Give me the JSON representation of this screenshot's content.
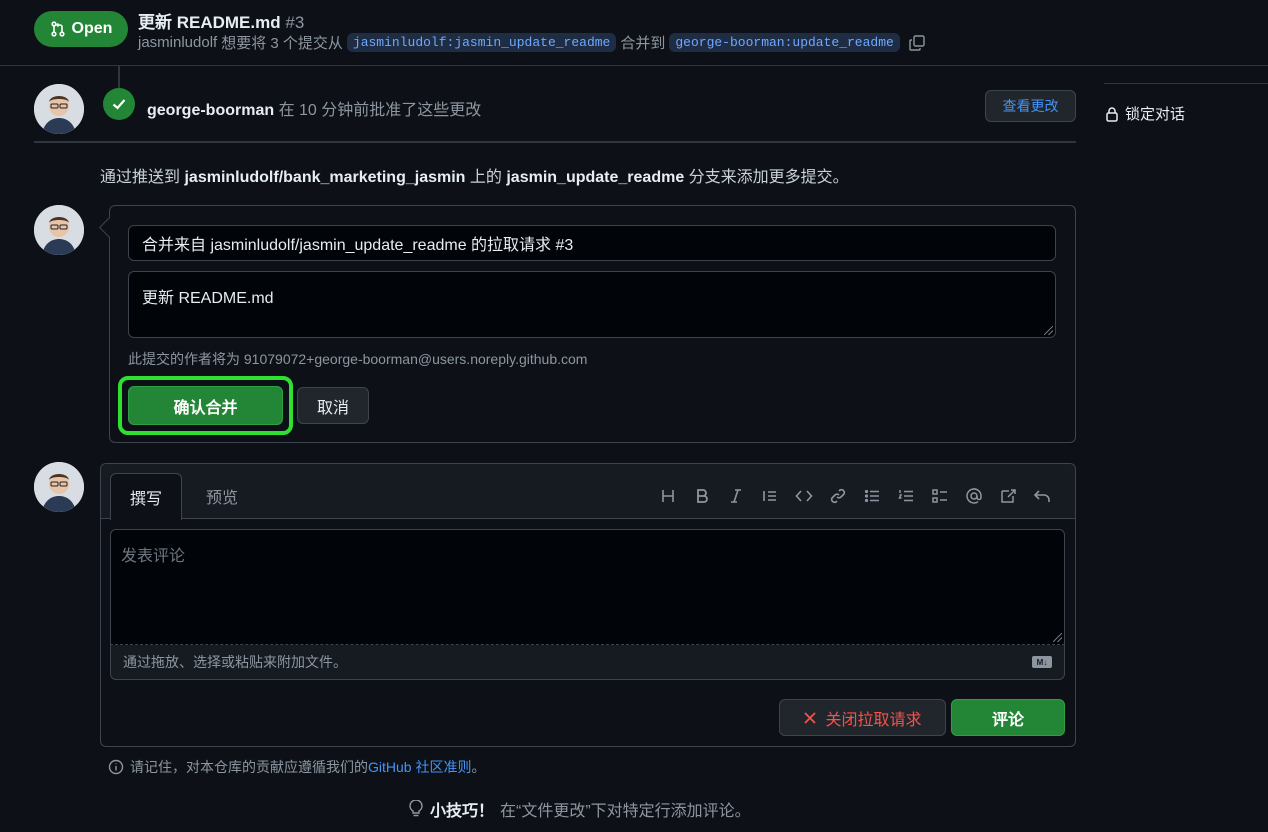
{
  "header": {
    "status": "Open",
    "title": "更新 README.md",
    "number": "#3",
    "author": "jasminludolf",
    "wants_to": "想要将 3 个提交从",
    "head_branch": "jasminludolf:jasmin_update_readme",
    "merge_into": "合并到",
    "base_branch": "george-boorman:update_readme"
  },
  "review": {
    "reviewer": "george-boorman",
    "action": "在 10 分钟前批准了这些更改",
    "view_changes": "查看更改"
  },
  "sidebar": {
    "lock_label": "锁定对话"
  },
  "push_hint": {
    "prefix": "通过推送到",
    "repo": "jasminludolf/bank_marketing_jasmin",
    "middle": "上的",
    "branch": "jasmin_update_readme",
    "suffix": "分支来添加更多提交。"
  },
  "merge": {
    "commit_title": "合并来自 jasminludolf/jasmin_update_readme 的拉取请求 #3",
    "commit_body": "更新 README.md",
    "author_note": "此提交的作者将为 91079072+george-boorman@users.noreply.github.com",
    "confirm": "确认合并",
    "cancel": "取消"
  },
  "comment": {
    "tab_write": "撰写",
    "tab_preview": "预览",
    "placeholder": "发表评论",
    "attach_hint": "通过拖放、选择或粘贴来附加文件。",
    "md_badge": "M↓",
    "close_pr": "关闭拉取请求",
    "submit": "评论"
  },
  "footer": {
    "guidelines_prefix": "请记住，对本仓库的贡献应遵循我们的",
    "guidelines_link": "GitHub 社区准则",
    "guidelines_suffix": "。",
    "protip_label": "小技巧！",
    "protip_text": "在“文件更改”下对特定行添加评论。"
  },
  "colors": {
    "accent_green": "#238636",
    "link_blue": "#4493f8",
    "danger_red": "#f85149",
    "highlight": "#30e030"
  }
}
